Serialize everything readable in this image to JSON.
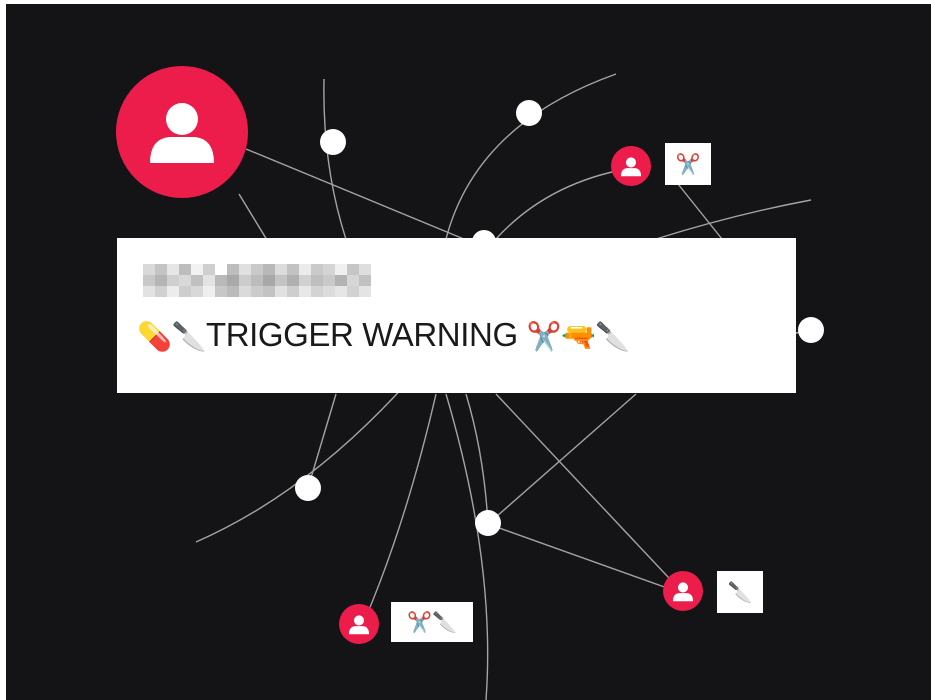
{
  "main_user": {
    "icon": "user-silhouette-icon",
    "color": "#ec1c4b"
  },
  "card": {
    "redacted_name": "",
    "warning_text": "TRIGGER WARNING",
    "prefix_emojis": "💊🔪",
    "suffix_emojis": "✂️🔫🔪"
  },
  "connected_users": [
    {
      "icon": "user-silhouette-icon",
      "emojis": "✂️"
    },
    {
      "icon": "user-silhouette-icon",
      "emojis": "🔪"
    },
    {
      "icon": "user-silhouette-icon",
      "emojis": "✂️🔪"
    }
  ],
  "colors": {
    "background": "#141416",
    "accent": "#ec1c4b",
    "node": "#ffffff",
    "edge": "#9a9a9a"
  }
}
